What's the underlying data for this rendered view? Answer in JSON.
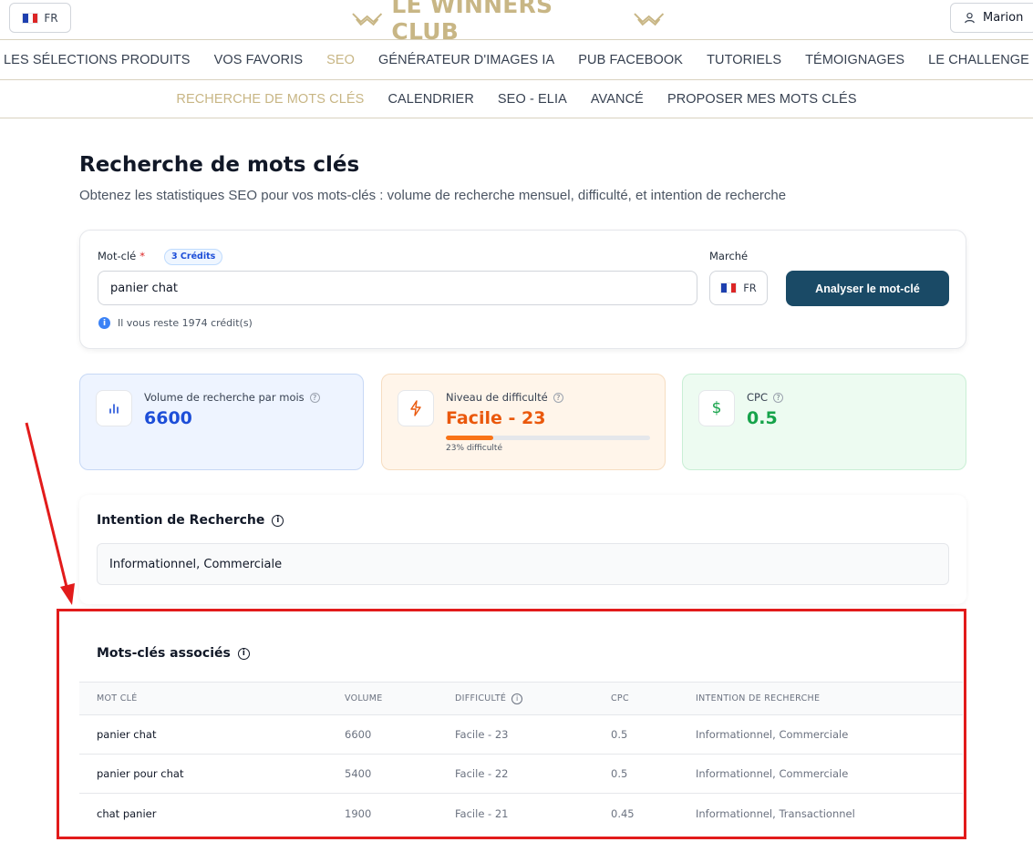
{
  "header": {
    "lang_label": "FR",
    "logo_text": "LE WINNERS CLUB",
    "user_name": "Marion"
  },
  "main_nav": [
    {
      "label": "LES SÉLECTIONS PRODUITS",
      "active": false
    },
    {
      "label": "VOS FAVORIS",
      "active": false
    },
    {
      "label": "SEO",
      "active": true
    },
    {
      "label": "GÉNÉRATEUR D'IMAGES IA",
      "active": false
    },
    {
      "label": "PUB FACEBOOK",
      "active": false
    },
    {
      "label": "TUTORIELS",
      "active": false
    },
    {
      "label": "TÉMOIGNAGES",
      "active": false
    },
    {
      "label": "LE CHALLENGE",
      "active": false
    }
  ],
  "sub_nav": [
    {
      "label": "RECHERCHE DE MOTS CLÉS",
      "active": true
    },
    {
      "label": "CALENDRIER",
      "active": false
    },
    {
      "label": "SEO - ELIA",
      "active": false
    },
    {
      "label": "AVANCÉ",
      "active": false
    },
    {
      "label": "PROPOSER MES MOTS CLÉS",
      "active": false
    }
  ],
  "page": {
    "title": "Recherche de mots clés",
    "subtitle": "Obtenez les statistiques SEO pour vos mots-clés : volume de recherche mensuel, difficulté, et intention de recherche"
  },
  "search": {
    "keyword_label": "Mot-clé",
    "required_mark": "*",
    "credits_badge": "3 Crédits",
    "keyword_value": "panier chat",
    "credits_info": "Il vous reste 1974 crédit(s)",
    "market_label": "Marché",
    "market_value": "FR",
    "analyze_button": "Analyser le mot-clé"
  },
  "stats": {
    "volume": {
      "label": "Volume de recherche par mois",
      "value": "6600"
    },
    "difficulty": {
      "label": "Niveau de difficulté",
      "value": "Facile - 23",
      "fraction": 0.23,
      "caption": "23% difficulté"
    },
    "cpc": {
      "label": "CPC",
      "value": "0.5"
    }
  },
  "intent": {
    "title": "Intention de Recherche",
    "value": "Informationnel, Commerciale"
  },
  "related": {
    "title": "Mots-clés associés",
    "columns": [
      "MOT CLÉ",
      "VOLUME",
      "DIFFICULTÉ",
      "CPC",
      "INTENTION DE RECHERCHE"
    ],
    "rows": [
      [
        "panier chat",
        "6600",
        "Facile - 23",
        "0.5",
        "Informationnel, Commerciale"
      ],
      [
        "panier pour chat",
        "5400",
        "Facile - 22",
        "0.5",
        "Informationnel, Commerciale"
      ],
      [
        "chat panier",
        "1900",
        "Facile - 21",
        "0.45",
        "Informationnel, Transactionnel"
      ]
    ]
  },
  "colors": {
    "gold_accent": "#c8b685",
    "primary_button": "#1a4a66",
    "annotation_red": "#e21b1b"
  }
}
